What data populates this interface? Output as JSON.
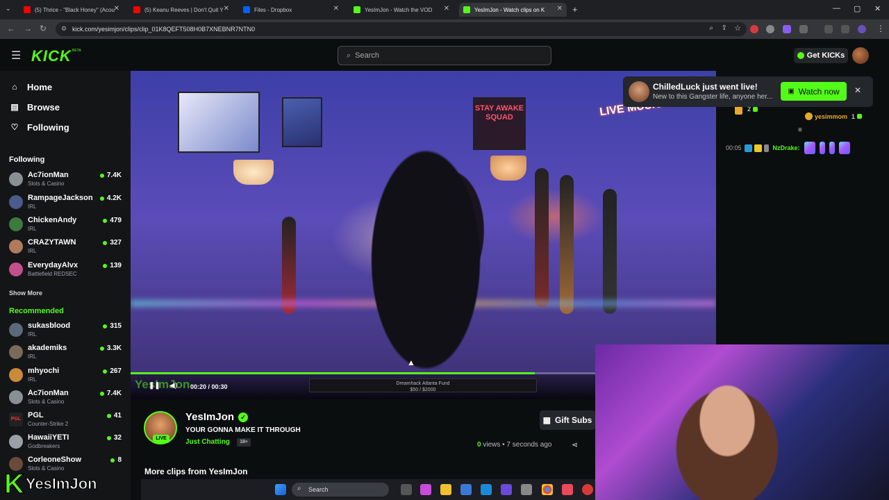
{
  "browser": {
    "tabs": [
      {
        "title": "(5) Thrice - \"Black Honey\" (Acou",
        "color": "#ff0000"
      },
      {
        "title": "(5) Keanu Reeves | Don't Quit Y",
        "color": "#ff0000"
      },
      {
        "title": "Files - Dropbox",
        "color": "#0061fe"
      },
      {
        "title": "YesImJon - Watch the VOD",
        "color": "#53fc18"
      },
      {
        "title": "YesImJon - Watch clips on K",
        "color": "#53fc18"
      }
    ],
    "url": "kick.com/yesimjon/clips/clip_01K8QEFT508H0B7XNEBNR7NTN0"
  },
  "header": {
    "logo": "KICK",
    "beta": "BETA",
    "search_placeholder": "Search",
    "get_kicks": "Get KICKs"
  },
  "sidebar": {
    "nav": [
      {
        "label": "Home",
        "icon": "home-icon"
      },
      {
        "label": "Browse",
        "icon": "browse-icon"
      },
      {
        "label": "Following",
        "icon": "heart-icon"
      }
    ],
    "following_title": "Following",
    "following": [
      {
        "name": "Ac7ionMan",
        "category": "Slots & Casino",
        "viewers": "7.4K"
      },
      {
        "name": "RampageJackson",
        "category": "IRL",
        "viewers": "4.2K"
      },
      {
        "name": "ChickenAndy",
        "category": "IRL",
        "viewers": "479"
      },
      {
        "name": "CRAZYTAWN",
        "category": "IRL",
        "viewers": "327"
      },
      {
        "name": "EverydayAlvx",
        "category": "Battlefield REDSEC",
        "viewers": "139"
      }
    ],
    "show_more": "Show More",
    "recommended_title": "Recommended",
    "recommended": [
      {
        "name": "sukasblood",
        "category": "IRL",
        "viewers": "315"
      },
      {
        "name": "akademiks",
        "category": "IRL",
        "viewers": "3.3K"
      },
      {
        "name": "mhyochi",
        "category": "IRL",
        "viewers": "267"
      },
      {
        "name": "Ac7ionMan",
        "category": "Slots & Casino",
        "viewers": "7.4K"
      },
      {
        "name": "PGL",
        "category": "Counter-Strike 2",
        "viewers": "41"
      },
      {
        "name": "HawaiiYETI",
        "category": "Godbreakers",
        "viewers": "32"
      },
      {
        "name": "CorleoneShow",
        "category": "Slots & Casino",
        "viewers": "8"
      }
    ],
    "watermark": "YesImJon"
  },
  "video": {
    "live_music_sign": "LIVE MUSIC",
    "poster_text": "STAY AWAKE SQUAD",
    "time": "00:20 / 00:30",
    "progress": 0.87,
    "fund_text": "Dreamhack Atlanta Fund",
    "fund_amount": "$50 / $2000",
    "watermark": "YesImJon"
  },
  "notification": {
    "title": "ChilledLuck just went live!",
    "subtitle": "New to this Gangster life, anyone her...",
    "button": "Watch now"
  },
  "chat": {
    "lines": [
      {
        "user": "yesimmom",
        "badge": "1"
      },
      {
        "time": "00:05",
        "user": "NzDrake:"
      }
    ],
    "top_badge_num": "2"
  },
  "stream_info": {
    "name": "YesImJon",
    "title": "YOUR GONNA MAKE IT THROUGH",
    "category": "Just Chatting",
    "rating": "18+",
    "live": "LIVE",
    "gift_subs": "Gift Subs",
    "views_count": "0",
    "views_label": "views",
    "time_ago": "• 7 seconds ago",
    "more_clips": "More clips from YesImJon"
  },
  "taskbar": {
    "search": "Search"
  },
  "colors": {
    "kick_green": "#53fc18",
    "bg": "#0b0e0f",
    "sidebar": "#141517"
  }
}
